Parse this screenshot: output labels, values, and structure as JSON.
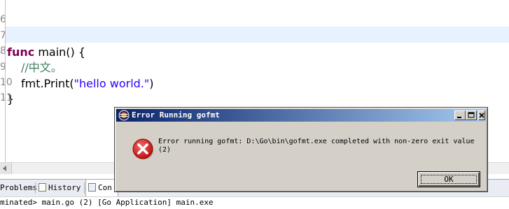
{
  "editor": {
    "lines": [
      {
        "num": "6",
        "code": ""
      },
      {
        "num": "7",
        "keyword": "func",
        "rest": " main() {"
      },
      {
        "num": "8",
        "comment": "//中文。"
      },
      {
        "num": "9",
        "pre": "    fmt.Print(",
        "string": "\"hello world.\"",
        "post": ")"
      },
      {
        "num": "10",
        "code": "}"
      },
      {
        "num": "11",
        "code": ""
      }
    ]
  },
  "bottom_panel": {
    "tabs": [
      {
        "label": "Problems",
        "icon": "problems-icon"
      },
      {
        "label": "History",
        "icon": "history-icon"
      },
      {
        "label": "Con",
        "icon": "console-icon"
      }
    ],
    "console_status": "minated> main.go (2) [Go Application] main.exe"
  },
  "dialog": {
    "title": "Error Running gofmt",
    "title_buttons": {
      "minimize": "_",
      "maximize": "□",
      "close": "X"
    },
    "message": "Error running gofmt: D:\\Go\\bin\\gofmt.exe completed with non-zero exit value (2)",
    "ok_label": "OK",
    "icon": "error-icon"
  },
  "colors": {
    "titlebar_start": "#0a246a",
    "titlebar_end": "#a6caf0",
    "dialog_face": "#d4d0c8",
    "error_red": "#d0181c",
    "keyword": "#7f0055",
    "comment": "#3f7f5f",
    "string": "#2a00ff",
    "current_line": "#e8f2fe"
  }
}
